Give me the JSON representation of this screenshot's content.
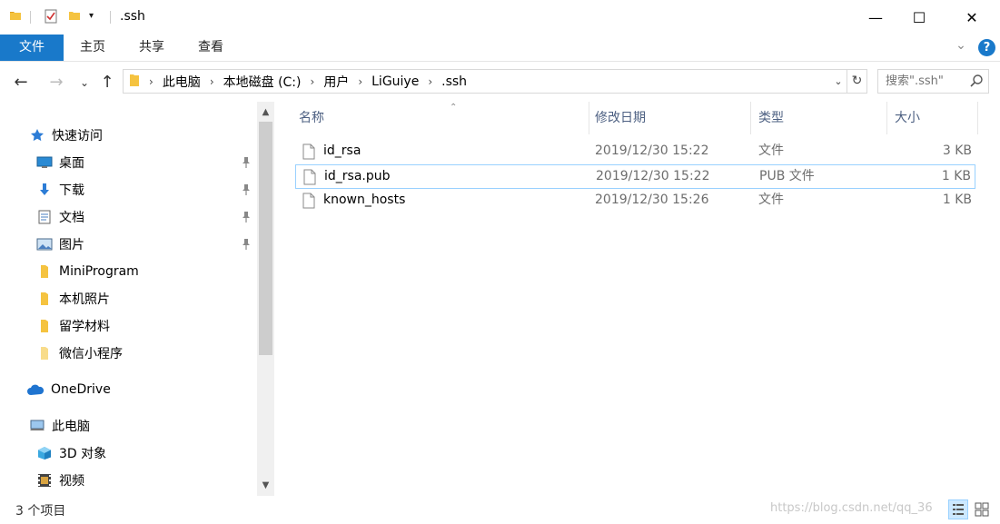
{
  "window": {
    "title": ".ssh",
    "minimize_glyph": "—",
    "maximize_glyph": "☐",
    "close_glyph": "✕"
  },
  "ribbon": {
    "tabs": [
      {
        "label": "文件",
        "active": true
      },
      {
        "label": "主页"
      },
      {
        "label": "共享"
      },
      {
        "label": "查看"
      }
    ],
    "help_label": "?",
    "collapse_glyph": "⌄"
  },
  "navigation": {
    "back_glyph": "←",
    "forward_glyph": "→",
    "recent_glyph": "⌄",
    "up_glyph": "↑",
    "breadcrumbs": [
      "此电脑",
      "本地磁盘 (C:)",
      "用户",
      "LiGuiye",
      ".ssh"
    ],
    "separator": "›",
    "dropdown_glyph": "⌄",
    "refresh_glyph": "↻",
    "search_placeholder": "搜索\".ssh\""
  },
  "sidebar": {
    "items": [
      {
        "label": "快速访问",
        "icon": "star-icon"
      },
      {
        "label": "桌面",
        "icon": "desktop-icon",
        "pinned": true
      },
      {
        "label": "下载",
        "icon": "download-icon",
        "pinned": true
      },
      {
        "label": "文档",
        "icon": "document-icon",
        "pinned": true
      },
      {
        "label": "图片",
        "icon": "picture-icon",
        "pinned": true
      },
      {
        "label": "MiniProgram",
        "icon": "folder-icon"
      },
      {
        "label": "本机照片",
        "icon": "folder-icon"
      },
      {
        "label": "留学材料",
        "icon": "folder-icon"
      },
      {
        "label": "微信小程序",
        "icon": "folder-icon"
      },
      {
        "label": "OneDrive",
        "icon": "cloud-icon"
      },
      {
        "label": "此电脑",
        "icon": "computer-icon"
      },
      {
        "label": "3D 对象",
        "icon": "cube-icon"
      },
      {
        "label": "视频",
        "icon": "video-icon"
      }
    ],
    "scroll_up_glyph": "▲",
    "scroll_down_glyph": "▼"
  },
  "file_list": {
    "columns": [
      "名称",
      "修改日期",
      "类型",
      "大小"
    ],
    "sort_glyph": "⌃",
    "files": [
      {
        "name": "id_rsa",
        "modified": "2019/12/30 15:22",
        "type": "文件",
        "size": "3 KB"
      },
      {
        "name": "id_rsa.pub",
        "modified": "2019/12/30 15:22",
        "type": "PUB 文件",
        "size": "1 KB",
        "selected": true
      },
      {
        "name": "known_hosts",
        "modified": "2019/12/30 15:26",
        "type": "文件",
        "size": "1 KB"
      }
    ]
  },
  "status": {
    "item_count": "3 个项目",
    "watermark": "https://blog.csdn.net/qq_36"
  },
  "colors": {
    "accent": "#1979ca",
    "selection_border": "#99d1ff",
    "folder": "#f5c340",
    "header_text": "#4d6082"
  }
}
